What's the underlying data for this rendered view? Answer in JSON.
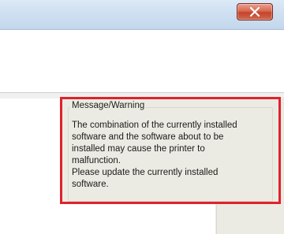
{
  "window": {
    "close_icon": "close-icon",
    "close_color": "#c5432a"
  },
  "message_panel": {
    "group_title": "Message/Warning",
    "message": "The combination of the currently installed\nsoftware and the software about to be\ninstalled may cause the printer to\nmalfunction.\nPlease update the currently installed\nsoftware.",
    "highlight_color": "#e0222b"
  }
}
